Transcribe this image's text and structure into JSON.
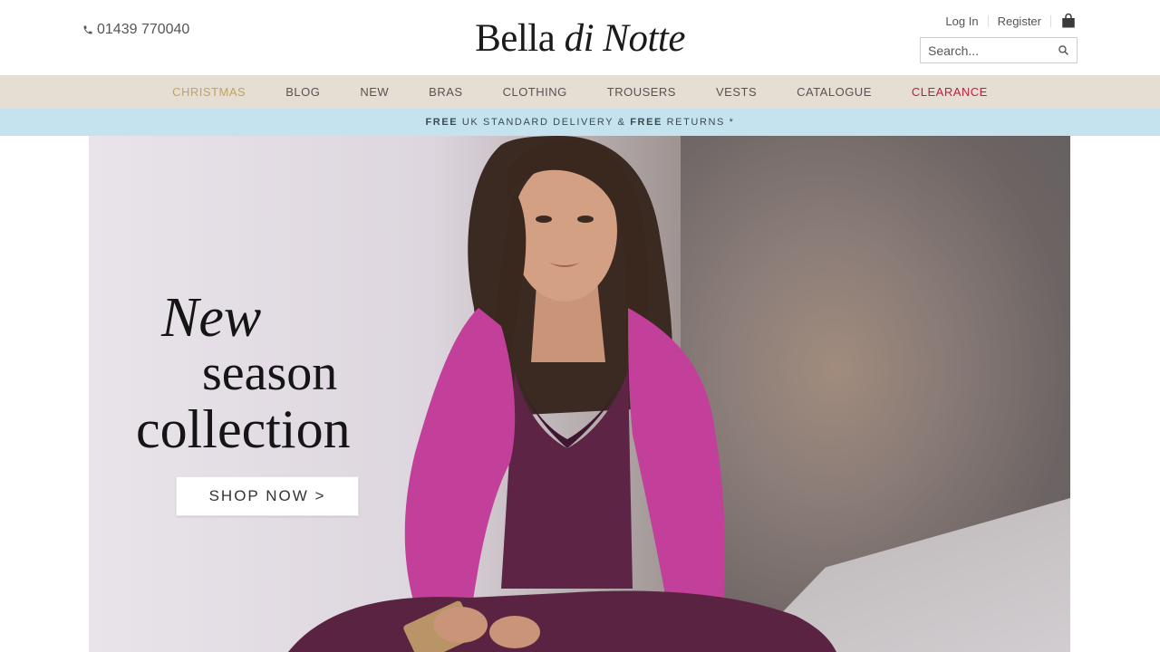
{
  "header": {
    "phone": "01439 770040",
    "logo_main": "Bella",
    "logo_italic": "di Notte",
    "login_label": "Log In",
    "register_label": "Register",
    "search_placeholder": "Search..."
  },
  "nav": {
    "items": [
      {
        "label": "CHRISTMAS"
      },
      {
        "label": "BLOG"
      },
      {
        "label": "NEW"
      },
      {
        "label": "BRAS"
      },
      {
        "label": "CLOTHING"
      },
      {
        "label": "TROUSERS"
      },
      {
        "label": "VESTS"
      },
      {
        "label": "CATALOGUE"
      },
      {
        "label": "CLEARANCE"
      }
    ]
  },
  "strip": {
    "free1": "FREE",
    "text1": "UK STANDARD DELIVERY &",
    "free2": "FREE",
    "text2": "RETURNS *"
  },
  "hero": {
    "line1": "New",
    "line2": "season",
    "line3": "collection",
    "cta": "SHOP NOW >"
  },
  "colors": {
    "nav_bg": "#e6ddd3",
    "strip_bg": "#c5e3ef",
    "christmas": "#c2a55a",
    "clearance": "#c2203a",
    "cardigan": "#c23f9a",
    "camisole": "#5e2446"
  },
  "icons": [
    "phone-icon",
    "bag-icon",
    "search-icon"
  ]
}
